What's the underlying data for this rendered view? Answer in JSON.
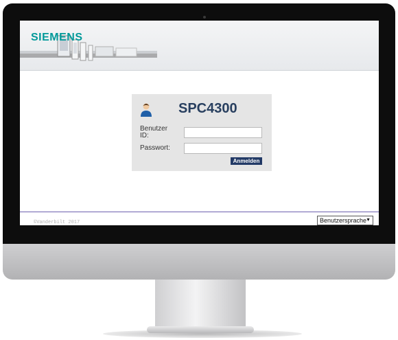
{
  "brand": {
    "logo_text": "SIEMENS",
    "color": "#009999"
  },
  "login": {
    "product_name": "SPC4300",
    "user_id_label": "Benutzer ID:",
    "user_id_value": "",
    "password_label": "Passwort:",
    "password_value": "",
    "submit_label": "Anmelden",
    "button_color": "#223a66"
  },
  "footer": {
    "copyright": "©Vanderbilt 2017",
    "language_select": "Benutzersprache"
  },
  "icons": {
    "user": "user-icon",
    "dropdown": "dropdown-arrow-icon"
  }
}
